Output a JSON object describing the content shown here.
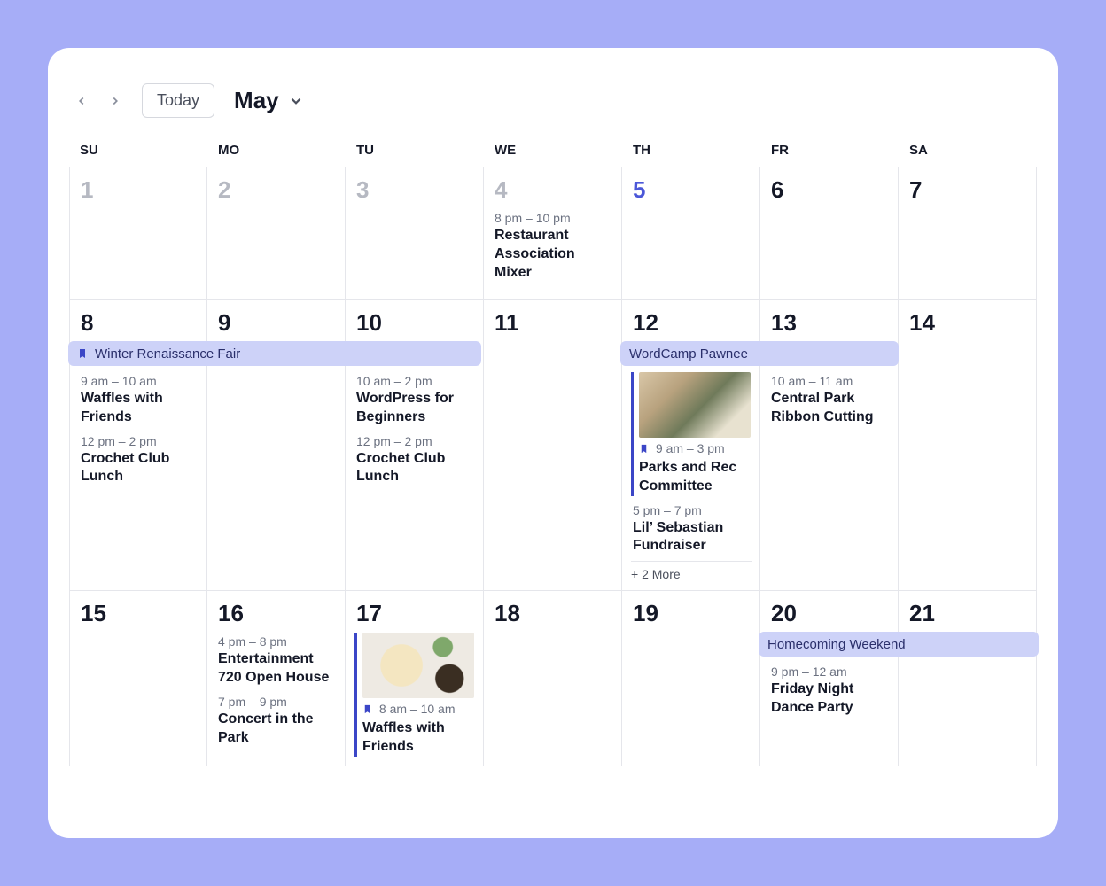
{
  "toolbar": {
    "today_label": "Today",
    "month_label": "May"
  },
  "dow": [
    "SU",
    "MO",
    "TU",
    "WE",
    "TH",
    "FR",
    "SA"
  ],
  "span_events": {
    "winter_fair": "Winter Renaissance Fair",
    "wordcamp": "WordCamp Pawnee",
    "homecoming": "Homecoming Weekend"
  },
  "days": {
    "d1": {
      "num": "1"
    },
    "d2": {
      "num": "2"
    },
    "d3": {
      "num": "3"
    },
    "d4": {
      "num": "4",
      "events": [
        {
          "time": "8 pm – 10 pm",
          "title": "Restaurant Association Mixer"
        }
      ]
    },
    "d5": {
      "num": "5"
    },
    "d6": {
      "num": "6"
    },
    "d7": {
      "num": "7"
    },
    "d8": {
      "num": "8",
      "events": [
        {
          "time": "9 am – 10 am",
          "title": "Waffles with Friends"
        },
        {
          "time": "12 pm – 2 pm",
          "title": "Crochet Club Lunch"
        }
      ]
    },
    "d9": {
      "num": "9"
    },
    "d10": {
      "num": "10",
      "events": [
        {
          "time": "10 am – 2 pm",
          "title": "WordPress for Beginners"
        },
        {
          "time": "12 pm – 2 pm",
          "title": "Crochet Club Lunch"
        }
      ]
    },
    "d11": {
      "num": "11"
    },
    "d12": {
      "num": "12",
      "events": [
        {
          "time": "9 am – 3 pm",
          "title": "Parks and Rec Committee",
          "featured": true
        },
        {
          "time": "5 pm – 7 pm",
          "title": "Lil’ Sebastian Fundraiser"
        }
      ],
      "more": "+ 2 More"
    },
    "d13": {
      "num": "13",
      "events": [
        {
          "time": "10 am – 11 am",
          "title": "Central Park Ribbon Cutting"
        }
      ]
    },
    "d14": {
      "num": "14"
    },
    "d15": {
      "num": "15"
    },
    "d16": {
      "num": "16",
      "events": [
        {
          "time": "4 pm – 8 pm",
          "title": "Entertainment 720 Open House"
        },
        {
          "time": "7 pm – 9 pm",
          "title": "Concert in the Park"
        }
      ]
    },
    "d17": {
      "num": "17",
      "events": [
        {
          "time": "8 am – 10 am",
          "title": "Waffles with Friends",
          "featured": true
        }
      ]
    },
    "d18": {
      "num": "18"
    },
    "d19": {
      "num": "19"
    },
    "d20": {
      "num": "20",
      "events": [
        {
          "time": "9 pm – 12 am",
          "title": "Friday Night Dance Party"
        }
      ]
    },
    "d21": {
      "num": "21"
    }
  }
}
